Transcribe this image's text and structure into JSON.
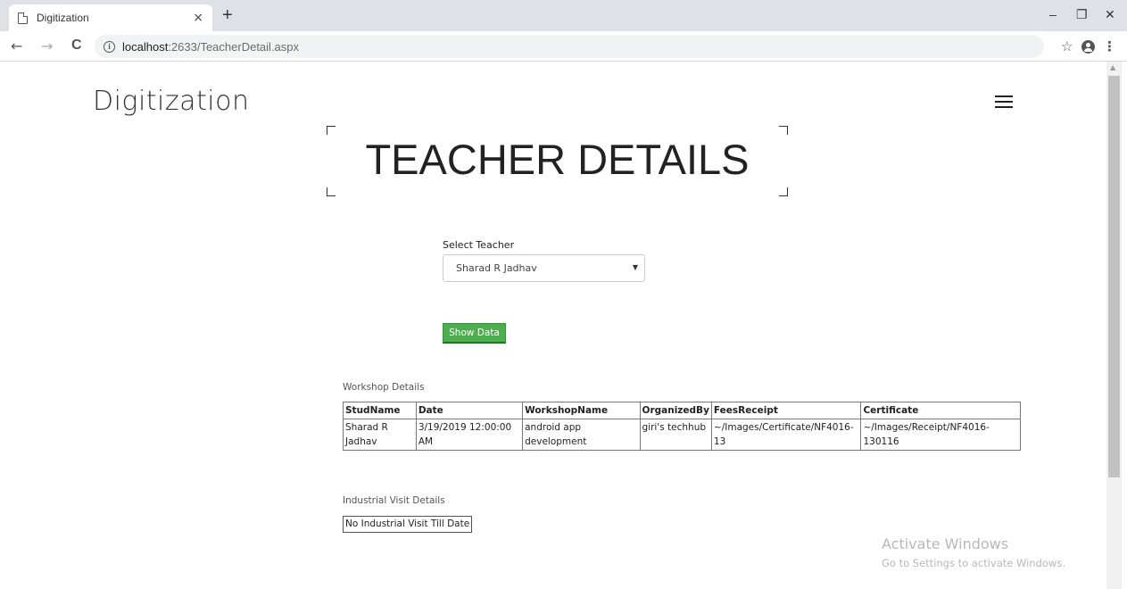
{
  "browser": {
    "tab_title": "Digitization",
    "tab_close": "×",
    "new_tab": "+",
    "url_host": "localhost",
    "url_path": ":2633/TeacherDetail.aspx",
    "nav_back": "←",
    "nav_forward": "→",
    "nav_reload": "C",
    "window_minimize": "–",
    "window_restore": "❐",
    "window_close": "✕",
    "bookmark_star": "☆",
    "menu": "⋮"
  },
  "site": {
    "brand": "Digitization"
  },
  "page": {
    "title": "TEACHER DETAILS"
  },
  "form": {
    "select_label": "Select Teacher",
    "selected_teacher": "Sharad R Jadhav",
    "show_button": "Show Data"
  },
  "workshop": {
    "label": "Workshop Details",
    "columns": [
      "StudName",
      "Date",
      "WorkshopName",
      "OrganizedBy",
      "FeesReceipt",
      "Certificate"
    ],
    "rows": [
      [
        "Sharad R Jadhav",
        "3/19/2019 12:00:00 AM",
        "android app development",
        "giri's techhub",
        "~/Images/Certificate/NF4016-13",
        "~/Images/Receipt/NF4016-130116"
      ]
    ]
  },
  "industrial_visit": {
    "label": "Industrial Visit Details",
    "message": "No Industrial Visit Till Date"
  },
  "watermark": {
    "title": "Activate Windows",
    "subtitle": "Go to Settings to activate Windows."
  }
}
